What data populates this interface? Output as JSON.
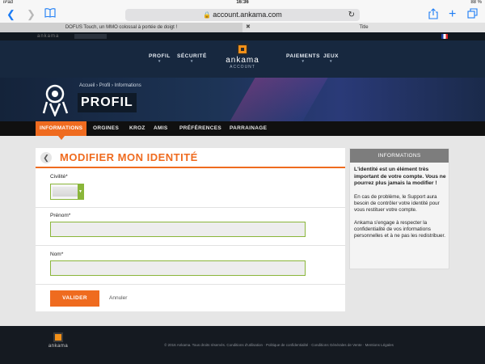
{
  "status_bar": {
    "device": "iPad",
    "time": "16:36",
    "battery": "88 %"
  },
  "browser": {
    "url": "account.ankama.com",
    "tabs": [
      {
        "label": "DOFUS Touch, un MMO colossal à portée de doigt !"
      },
      {
        "label": "Title"
      }
    ]
  },
  "header": {
    "brand": "ankama",
    "nav": [
      {
        "label": "PROFIL"
      },
      {
        "label": "SÉCURITÉ"
      },
      {
        "label": "PAIEMENTS"
      },
      {
        "label": "JEUX"
      }
    ],
    "logo_text": "ankama",
    "logo_sub": "ACCOUNT"
  },
  "banner": {
    "breadcrumb": [
      "Accueil",
      "Profil",
      "Informations"
    ],
    "title": "PROFIL"
  },
  "subnav": [
    {
      "label": "INFORMATIONS",
      "active": true
    },
    {
      "label": "ORGINES"
    },
    {
      "label": "KROZ"
    },
    {
      "label": "AMIS"
    },
    {
      "label": "PRÉFÉRENCES"
    },
    {
      "label": "PARRAINAGE"
    }
  ],
  "form": {
    "title": "MODIFIER MON IDENTITÉ",
    "civilite_label": "Civilité*",
    "prenom_label": "Prénom*",
    "prenom_value": "",
    "nom_label": "Nom*",
    "nom_value": "",
    "submit_label": "VALIDER",
    "cancel_label": "Annuler"
  },
  "info": {
    "heading": "INFORMATIONS",
    "strong": "L'identité est un élément très important de votre compte. Vous ne pourrez plus jamais la modifier !",
    "p1": "En cas de problème, le Support aura besoin de contrôler votre identité pour vous restituer votre compte.",
    "p2": "Ankama s'engage à respecter la confidentialité de vos informations personnelles et à ne pas les redistribuer."
  },
  "footer": {
    "logo_text": "ankama",
    "text": "© 2016 Ankama. Tous droits réservés. Conditions d'utilisation · Politique de confidentialité · Conditions Générales de Vente · Mentions Légales"
  },
  "colors": {
    "accent": "#ef6b1f",
    "header_bg": "#17283f",
    "field_border": "#8ab63a"
  }
}
